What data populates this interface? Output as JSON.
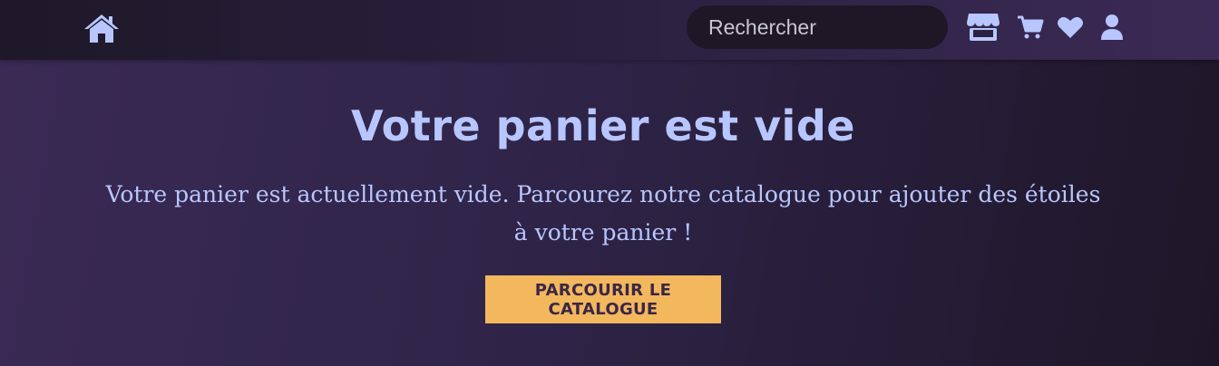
{
  "nav": {
    "home_icon": "home-icon",
    "search_placeholder": "Rechercher",
    "icons": [
      "store-icon",
      "cart-icon",
      "heart-icon",
      "user-icon"
    ]
  },
  "main": {
    "title": "Votre panier est vide",
    "description": "Votre panier est actuellement vide. Parcourez notre catalogue pour ajouter des étoiles à votre panier !",
    "cta_label": "PARCOURIR LE CATALOGUE"
  },
  "colors": {
    "accent": "#b8c6ff",
    "button": "#f3b75d",
    "button_text": "#3a2744",
    "search_bg": "#1f1726"
  }
}
